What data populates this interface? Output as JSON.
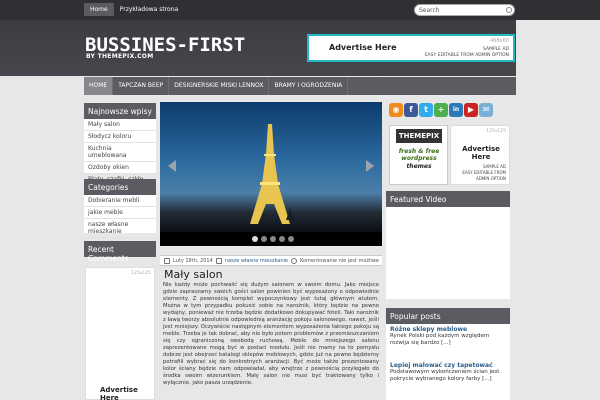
{
  "topnav": {
    "items": [
      {
        "label": "Home",
        "active": true
      },
      {
        "label": "Przykładowa strona",
        "active": false
      }
    ],
    "search_value": "Search"
  },
  "header": {
    "title": "BUSSINES-FIRST",
    "subtitle": "BY THEMEPIX.COM",
    "ad": {
      "size": "468x60",
      "title": "Advertise Here",
      "line1": "SAMPLE AD",
      "line2": "EASY EDITABLE FROM ADMIN OPTION"
    }
  },
  "mainnav": {
    "items": [
      {
        "label": "HOME",
        "active": true
      },
      {
        "label": "TAPCZAN BEEP",
        "active": false
      },
      {
        "label": "DESIGNERSKIE MISKI LENNOX",
        "active": false
      },
      {
        "label": "BRAMY I OGRODZENIA",
        "active": false
      }
    ]
  },
  "left": {
    "recent_posts": {
      "title": "Najnowsze wpisy",
      "items": [
        "Mały salon",
        "Słodycz koloru",
        "Kuchnia umeblowana",
        "Ozdoby okien",
        "Blaty, szafki, szkło"
      ]
    },
    "categories": {
      "title": "Categories",
      "items": [
        "Dobieranie mebli",
        "jakie meble",
        "nasze własne mieszkanie"
      ]
    },
    "recent_comments": {
      "title": "Recent Comments"
    },
    "ad": {
      "size": "125x125",
      "title": "Advertise Here"
    }
  },
  "post": {
    "date": "Luty 18th, 2014",
    "category": "nasze własne mieszkanie",
    "comments": "Komentowanie nie jest możliwe",
    "title": "Mały salon",
    "body": "Nie każdy może pochwalić się dużym salonem w swoim domu. Jako miejsce gdzie zapraszamy swoich gości salon powinien być wyposażony o odpowiednie elementy. Z pewnością komplet wypoczynkowy jest tutaj głównym atutem. Można w tym przypadku pokusić sobie na narożnik, który będzie na pewno wydajny, ponieważ nie trzeba będzie dodatkowo dokupywać foteli. Taki narożnik z ławą tworzy absolutnie odpowiednią aranżację pokoju salonowego, nawet, jeśli jest mniejszy. Oczywiście następnym elementem wyposażenia takiego pokoju są meble. Trzeba je tak dobrać, aby nie było potem problemów z przemieszczaniem się czy ograniczoną swobodą ruchową. Meble do mniejszego salonu zaprezentowane mogą być w postaci modułu. Jeśli nie mamy na to pomysłu dobrze jest obejrzeć katalogi sklepów meblowych, gdzie już na pewno będziemy potrafili wybrać się do konkretnych aranżacji. Być może także prezentowany kolor ściany będzie nam odpowiadał, aby wnętrze z pewnością przylegało do środka swoim wizerunkiem. Mały salon nie musi być traktowany tylko i wyłącznie, jako pasza urządzenie."
  },
  "slider": {
    "dots": 5,
    "active": 0
  },
  "right": {
    "social": [
      {
        "name": "rss-icon",
        "glyph": "◉",
        "color": "#f08a1c"
      },
      {
        "name": "facebook-icon",
        "glyph": "f",
        "color": "#3b5998"
      },
      {
        "name": "twitter-icon",
        "glyph": "t",
        "color": "#33aaee"
      },
      {
        "name": "plus-icon",
        "glyph": "+",
        "color": "#4caf50"
      },
      {
        "name": "linkedin-icon",
        "glyph": "in",
        "color": "#2a7ab7"
      },
      {
        "name": "youtube-icon",
        "glyph": "▶",
        "color": "#cc2222"
      },
      {
        "name": "email-icon",
        "glyph": "✉",
        "color": "#7bb0d6"
      }
    ],
    "themepix_ad": {
      "brand": "THEMEPIX",
      "line1": "fresh & free wordpress",
      "line2": "themes"
    },
    "ad125": {
      "size": "125x125",
      "title": "Advertise Here",
      "s1": "SAMPLE AD",
      "s2": "EASY EDITABLE FROM",
      "s3": "ADMIN OPTION"
    },
    "featured_video": {
      "title": "Featured Video"
    },
    "popular": {
      "title": "Popular posts",
      "posts": [
        {
          "title": "Różne sklepy meblowe",
          "excerpt": "Rynek Polski pod każdym względem rozwija się bardzo [...]"
        },
        {
          "title": "Lepiej malować czy tapetować",
          "excerpt": "Podstawowym wykończeniem ścian jest pokrycie wybranego kolory farby [...]"
        }
      ]
    }
  }
}
